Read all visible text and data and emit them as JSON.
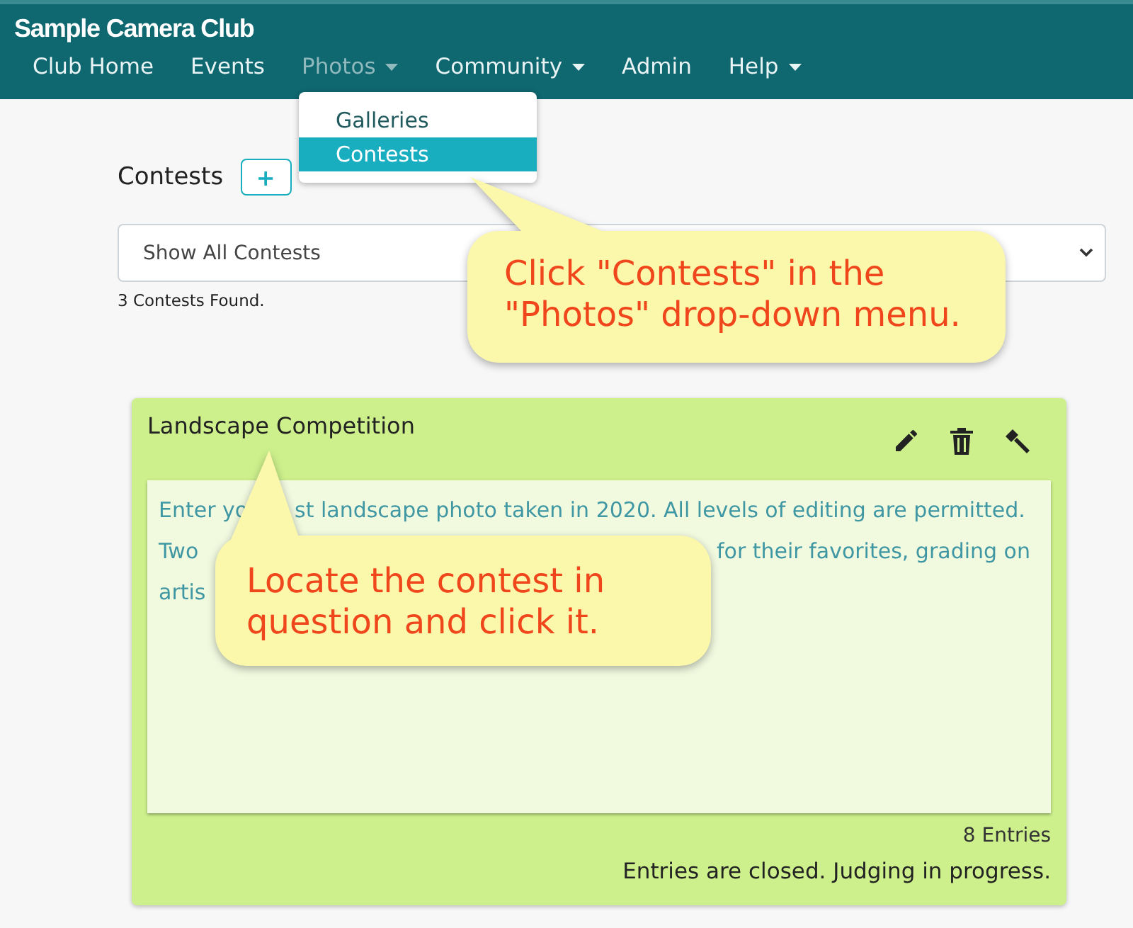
{
  "navbar": {
    "brand": "Sample Camera Club",
    "items": [
      {
        "label": "Club Home",
        "dropdown": false,
        "selected": false
      },
      {
        "label": "Events",
        "dropdown": false,
        "selected": false
      },
      {
        "label": "Photos",
        "dropdown": true,
        "selected": true
      },
      {
        "label": "Community",
        "dropdown": true,
        "selected": false
      },
      {
        "label": "Admin",
        "dropdown": false,
        "selected": false
      },
      {
        "label": "Help",
        "dropdown": true,
        "selected": false
      }
    ]
  },
  "dropdown_menu": {
    "items": [
      {
        "label": "Galleries",
        "selected": false
      },
      {
        "label": "Contests",
        "selected": true
      }
    ]
  },
  "page": {
    "heading": "Contests",
    "add_button": "+",
    "filter": {
      "value": "Show All Contests"
    },
    "count": "3 Contests Found."
  },
  "contest_card": {
    "title": "Landscape Competition",
    "description_lines": [
      {
        "left": "Enter yo",
        "right": "st landscape photo taken in 2020. All levels of editing are permitted."
      },
      {
        "left": "Two",
        "right": "for their favorites, grading on"
      },
      {
        "left": "artis"
      }
    ],
    "entries": "8 Entries",
    "status": "Entries are closed. Judging in progress."
  },
  "callouts": [
    {
      "text": "Click \"Contests\" in the \"Photos\" drop-down menu."
    },
    {
      "text": "Locate the contest in question and click it."
    }
  ]
}
